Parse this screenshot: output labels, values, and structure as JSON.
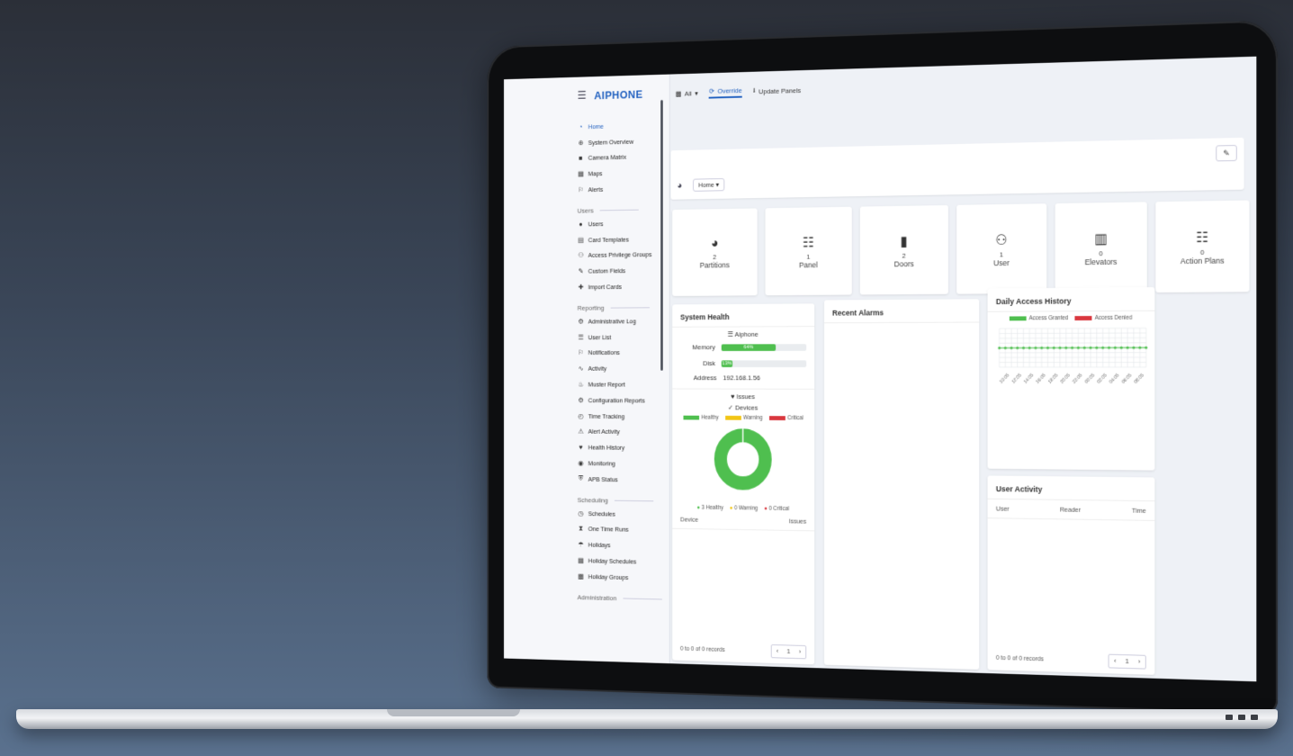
{
  "app": {
    "brand": "AIPHONE"
  },
  "sidebar": {
    "main": [
      {
        "label": "Home",
        "icon": "dashboard-icon",
        "active": true
      },
      {
        "label": "System Overview",
        "icon": "globe-icon"
      },
      {
        "label": "Camera Matrix",
        "icon": "video-camera-icon"
      },
      {
        "label": "Maps",
        "icon": "map-icon"
      },
      {
        "label": "Alerts",
        "icon": "bell-icon"
      }
    ],
    "users_section": "Users",
    "users": [
      {
        "label": "Users",
        "icon": "user-icon"
      },
      {
        "label": "Card Templates",
        "icon": "id-card-icon"
      },
      {
        "label": "Access Privilege Groups",
        "icon": "users-icon"
      },
      {
        "label": "Custom Fields",
        "icon": "pencil-icon"
      },
      {
        "label": "Import Cards",
        "icon": "user-plus-icon"
      }
    ],
    "reporting_section": "Reporting",
    "reporting": [
      {
        "label": "Administrative Log",
        "icon": "user-cog-icon"
      },
      {
        "label": "User List",
        "icon": "list-icon"
      },
      {
        "label": "Notifications",
        "icon": "bell-icon"
      },
      {
        "label": "Activity",
        "icon": "activity-icon"
      },
      {
        "label": "Muster Report",
        "icon": "fire-icon"
      },
      {
        "label": "Configuration Reports",
        "icon": "cogs-icon"
      },
      {
        "label": "Time Tracking",
        "icon": "stopwatch-icon"
      },
      {
        "label": "Alert Activity",
        "icon": "warning-icon"
      },
      {
        "label": "Health History",
        "icon": "heartbeat-icon"
      },
      {
        "label": "Monitoring",
        "icon": "eye-icon"
      },
      {
        "label": "APB Status",
        "icon": "user-shield-icon"
      }
    ],
    "scheduling_section": "Scheduling",
    "scheduling": [
      {
        "label": "Schedules",
        "icon": "clock-icon"
      },
      {
        "label": "One Time Runs",
        "icon": "hourglass-icon"
      },
      {
        "label": "Holidays",
        "icon": "umbrella-beach-icon"
      },
      {
        "label": "Holiday Schedules",
        "icon": "calendar-icon"
      },
      {
        "label": "Holiday Groups",
        "icon": "calendar-group-icon"
      }
    ],
    "administration_section": "Administration"
  },
  "topbar": {
    "all": "All",
    "override": "Override",
    "update_panels": "Update Panels"
  },
  "home_dropdown": "Home",
  "stats": [
    {
      "value": "2",
      "label": "Partitions",
      "icon": "pie-chart-icon"
    },
    {
      "value": "1",
      "label": "Panel",
      "icon": "network-icon"
    },
    {
      "value": "2",
      "label": "Doors",
      "icon": "door-icon"
    },
    {
      "value": "1",
      "label": "User",
      "icon": "users-icon"
    },
    {
      "value": "0",
      "label": "Elevators",
      "icon": "building-icon"
    },
    {
      "value": "0",
      "label": "Action Plans",
      "icon": "scroll-icon"
    }
  ],
  "system_health": {
    "title": "System Health",
    "server": "Aiphone",
    "memory_label": "Memory",
    "memory_pct": "64%",
    "memory_value": 0.64,
    "disk_label": "Disk",
    "disk_pct": "13%",
    "disk_value": 0.13,
    "ip": "192.168.1.56",
    "address_label": "Address",
    "issues": "Issues",
    "devices": "Devices",
    "legend": [
      "Healthy",
      "Warning",
      "Critical"
    ],
    "summary": [
      "3 Healthy",
      "0 Warning",
      "0 Critical"
    ],
    "cols": [
      "Device",
      "Issues"
    ],
    "records": "0 to 0 of 0 records",
    "page": "1",
    "colors": {
      "healthy": "#4fbf4f",
      "warning": "#f2c515",
      "critical": "#d9373e"
    }
  },
  "recent_alarms": {
    "title": "Recent Alarms"
  },
  "daily_access": {
    "title": "Daily Access History",
    "legend": [
      "Access Granted",
      "Access Denied"
    ]
  },
  "user_activity": {
    "title": "User Activity",
    "cols": [
      "User",
      "Reader",
      "Time"
    ],
    "records": "0 to 0 of 0 records",
    "page": "1"
  },
  "chart_data": {
    "type": "line",
    "title": "Daily Access History",
    "x": [
      "10:05",
      "12:05",
      "14:05",
      "16:05",
      "18:05",
      "20:05",
      "22:05",
      "00:05",
      "02:05",
      "04:05",
      "06:05",
      "08:05"
    ],
    "series": [
      {
        "name": "Access Granted",
        "values": [
          0,
          0,
          0,
          0,
          0,
          0,
          0,
          0,
          0,
          0,
          0,
          0
        ]
      },
      {
        "name": "Access Denied",
        "values": [
          0,
          0,
          0,
          0,
          0,
          0,
          0,
          0,
          0,
          0,
          0,
          0
        ]
      }
    ]
  }
}
